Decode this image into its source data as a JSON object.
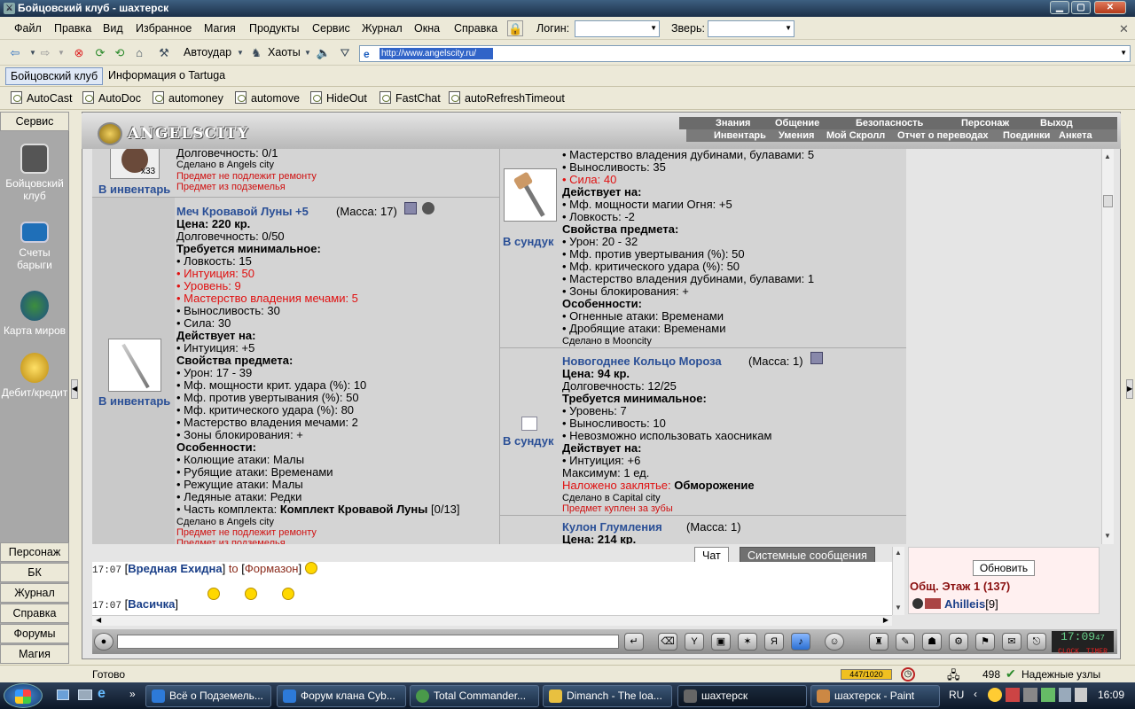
{
  "window": {
    "title": "Бойцовский клуб - шахтерск"
  },
  "menu": {
    "items": [
      "Файл",
      "Правка",
      "Вид",
      "Избранное",
      "Магия",
      "Продукты",
      "Сервис",
      "Журнал",
      "Окна",
      "Справка"
    ],
    "login_label": "Логин:",
    "pet_label": "Зверь:"
  },
  "toolbar": {
    "autoudar": "Автоудар",
    "haoty": "Хаоты"
  },
  "address": {
    "value": "http://www.angelscity.ru/"
  },
  "tabs": [
    "Бойцовский клуб",
    "Информация о Tartuga"
  ],
  "links": [
    "AutoCast",
    "AutoDoc",
    "automoney",
    "automove",
    "HideOut",
    "FastChat",
    "autoRefreshTimeout"
  ],
  "left": {
    "header": "Сервис",
    "items": [
      "Бойцовский клуб",
      "Счеты барыги",
      "Карта миров",
      "Дебит/кредит"
    ],
    "bottom": [
      "Персонаж",
      "БК",
      "Журнал",
      "Справка",
      "Форумы",
      "Магия"
    ]
  },
  "game": {
    "logo": "ANGELSCITY",
    "nav_top": [
      "Знания",
      "Общение",
      "Безопасность",
      "Персонаж",
      "Выход"
    ],
    "nav_bottom": [
      "Инвентарь",
      "Умения",
      "Мой Скролл",
      "Отчет о переводах",
      "Поединки",
      "Анкета"
    ]
  },
  "items": {
    "left_top": {
      "count": "x33",
      "lines": [
        "Долговечность: 0/1",
        "Сделано в Angels city",
        "Предмет не подлежит ремонту",
        "Предмет из подземелья"
      ],
      "link": "В инвентарь"
    },
    "sword": {
      "name": "Меч Кровавой Луны +5",
      "mass": "(Масса: 17)",
      "link": "В инвентарь",
      "lines": [
        "Цена: 220 кр.",
        "Долговечность: 0/50",
        "Требуется минимальное:",
        "• Ловкость: 15",
        "• Интуиция: 50",
        "• Уровень: 9",
        "• Мастерство владения мечами: 5",
        "• Выносливость: 30",
        "• Сила: 30",
        "Действует на:",
        "• Интуиция: +5",
        "Свойства предмета:",
        "• Урон: 17 - 39",
        "• Мф. мощности крит. удара (%): 10",
        "• Мф. против увертывания (%): 50",
        "• Мф. критического удара (%): 80",
        "• Мастерство владения мечами: 2",
        "• Зоны блокирования: +",
        "Особенности:",
        "• Колющие атаки: Малы",
        "• Рубящие атаки: Временами",
        "• Режущие атаки: Малы",
        "• Ледяные атаки: Редки",
        "• Часть комплекта: ",
        "Сделано в Angels city",
        "Предмет не подлежит ремонту",
        "Предмет из подземелья"
      ],
      "set_name": "Комплект Кровавой Луны",
      "set_count": "[0/13]"
    },
    "mace": {
      "link": "В сундук",
      "lines": [
        "• Мастерство владения дубинами, булавами: 5",
        "• Выносливость: 35",
        "• Сила: 40",
        "Действует на:",
        "• Мф. мощности магии Огня: +5",
        "• Ловкость: -2",
        "Свойства предмета:",
        "• Урон: 20 - 32",
        "• Мф. против увертывания (%): 50",
        "• Мф. критического удара (%): 50",
        "• Мастерство владения дубинами, булавами: 1",
        "• Зоны блокирования: +",
        "Особенности:",
        "• Огненные атаки: Временами",
        "• Дробящие атаки: Временами",
        "Сделано в Mooncity"
      ]
    },
    "ring": {
      "name": "Новогоднее Кольцо Мороза",
      "mass": "(Масса: 1)",
      "link": "В сундук",
      "lines": [
        "Цена: 94 кр.",
        "Долговечность: 12/25",
        "Требуется минимальное:",
        "• Уровень: 7",
        "• Выносливость: 10",
        "• Невозможно использовать хаосникам",
        "Действует на:",
        "• Интуиция: +6",
        "Максимум: 1 ед.",
        "Наложено заклятье: ",
        "Сделано в Capital city",
        "Предмет куплен за зубы"
      ],
      "spell": "Обморожение"
    },
    "amulet": {
      "name": "Кулон Глумления",
      "mass": "(Масса: 1)",
      "price": "Цена: 214 кр."
    }
  },
  "chat": {
    "tab_chat": "Чат",
    "tab_system": "Системные сообщения",
    "lines": [
      {
        "time": "17:07",
        "from": "Вредная Ехидна",
        "mid": "to",
        "to": "Формазон"
      },
      {
        "time": "17:07",
        "from": "Васичка"
      }
    ]
  },
  "users": {
    "refresh": "Обновить",
    "room": "Общ. Этаж 1 (137)",
    "first_user": "Ahilleis",
    "first_level": "[9]"
  },
  "clock": {
    "time": "17:09",
    "sec": "47",
    "label1": "CLOCK",
    "label2": "TIMER"
  },
  "status": {
    "left": "Готово",
    "counter": "447/1020",
    "num": "498",
    "zone": "Надежные узлы"
  },
  "taskbar": {
    "items": [
      "Всё о Подземель...",
      "Форум клана Cyb...",
      "Total Commander...",
      "Dimanch - The loa...",
      "шахтерск",
      "шахтерск - Paint"
    ],
    "lang": "RU",
    "time": "16:09"
  }
}
